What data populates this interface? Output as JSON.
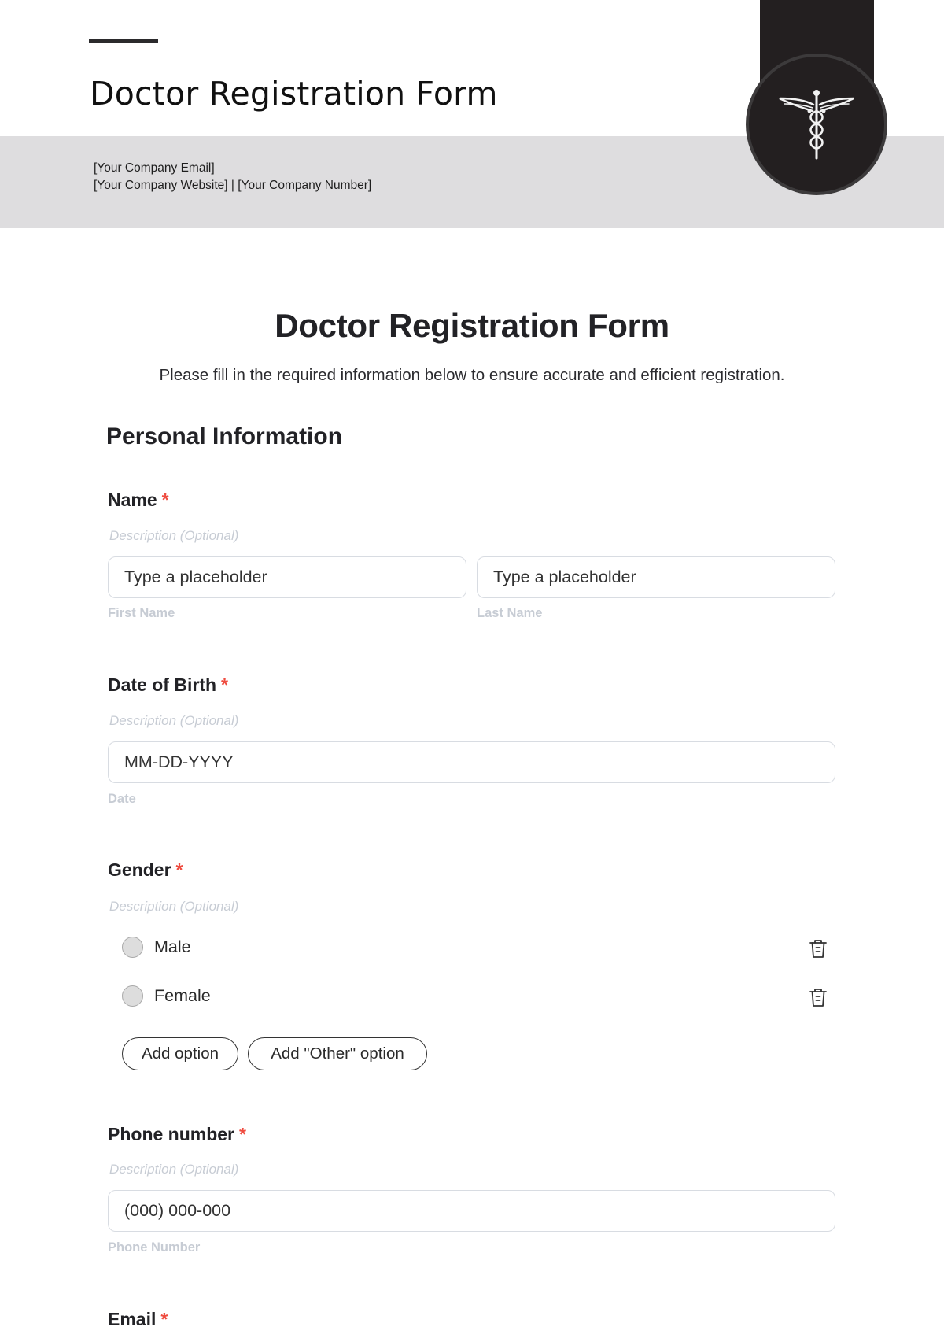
{
  "header": {
    "title": "Doctor Registration Form",
    "contact_line1": "[Your Company Email]",
    "contact_line2": "[Your Company Website] | [Your Company Number]",
    "emblem_icon": "caduceus-icon"
  },
  "form": {
    "title": "Doctor Registration Form",
    "subtitle": "Please fill in the required information below to ensure accurate and efficient registration.",
    "section_title": "Personal Information",
    "required_marker": "*",
    "fields": {
      "name": {
        "label": "Name",
        "description": "Description (Optional)",
        "first_placeholder": "Type a placeholder",
        "first_sublabel": "First Name",
        "last_placeholder": "Type a placeholder",
        "last_sublabel": "Last Name"
      },
      "dob": {
        "label": "Date of Birth",
        "description": "Description (Optional)",
        "placeholder": "MM-DD-YYYY",
        "sublabel": "Date"
      },
      "gender": {
        "label": "Gender",
        "description": "Description (Optional)",
        "options": [
          {
            "label": "Male",
            "selected": false
          },
          {
            "label": "Female",
            "selected": false
          }
        ],
        "add_option_label": "Add option",
        "add_other_label": "Add \"Other\" option"
      },
      "phone": {
        "label": "Phone number",
        "description": "Description (Optional)",
        "placeholder": "(000) 000-000",
        "sublabel": "Phone Number"
      },
      "email": {
        "label": "Email"
      }
    }
  },
  "colors": {
    "required": "#ef4b3f",
    "header_band": "#dedddf",
    "emblem": "#231f20"
  }
}
